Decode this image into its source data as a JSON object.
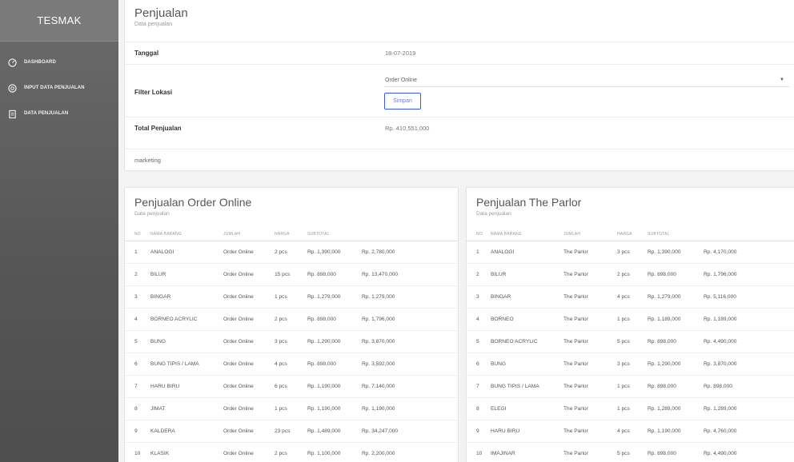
{
  "brand": "TESMAK",
  "nav": [
    {
      "label": "DASHBOARD",
      "icon": "dashboard-gauge-icon"
    },
    {
      "label": "INPUT DATA PENJUALAN",
      "icon": "input-circle-icon"
    },
    {
      "label": "DATA PENJUALAN",
      "icon": "clipboard-icon"
    }
  ],
  "header": {
    "title": "Penjualan",
    "subtitle": "Data penjualan"
  },
  "form": {
    "tanggal_label": "Tanggal",
    "tanggal_value": "18-07-2019",
    "filter_label": "Filter Lokasi",
    "filter_value": "Order Online",
    "simpan_label": "Simpan",
    "total_label": "Total Penjualan",
    "total_value": "Rp. 410,551,000",
    "note": "marketing"
  },
  "tables": [
    {
      "title": "Penjualan Order Online",
      "subtitle": "Data penjualan",
      "headers": [
        "NO",
        "NAMA BARANG",
        "JUMLAH",
        "HARGA",
        "SUBTOTAL",
        ""
      ],
      "rows": [
        [
          "1",
          "ANALOGI",
          "Order Online",
          "2 pcs",
          "Rp. 1,390,000",
          "Rp. 2,780,000"
        ],
        [
          "2",
          "BILUR",
          "Order Online",
          "15 pcs",
          "Rp. 898,000",
          "Rp. 13,470,000"
        ],
        [
          "3",
          "BINGAR",
          "Order Online",
          "1 pcs",
          "Rp. 1,279,000",
          "Rp. 1,279,000"
        ],
        [
          "4",
          "BORNEO ACRYLIC",
          "Order Online",
          "2 pcs",
          "Rp. 898,000",
          "Rp. 1,796,000"
        ],
        [
          "5",
          "BUNG",
          "Order Online",
          "3 pcs",
          "Rp. 1,290,000",
          "Rp. 3,870,000"
        ],
        [
          "6",
          "BUNG TIPIS / LAMA",
          "Order Online",
          "4 pcs",
          "Rp. 898,000",
          "Rp. 3,592,000"
        ],
        [
          "7",
          "HARU BIRU",
          "Order Online",
          "6 pcs",
          "Rp. 1,190,000",
          "Rp. 7,140,000"
        ],
        [
          "8",
          "JIMAT",
          "Order Online",
          "1 pcs",
          "Rp. 1,190,000",
          "Rp. 1,190,000"
        ],
        [
          "9",
          "KALDERA",
          "Order Online",
          "23 pcs",
          "Rp. 1,489,000",
          "Rp. 34,247,000"
        ],
        [
          "10",
          "KLASIK",
          "Order Online",
          "2 pcs",
          "Rp. 1,100,000",
          "Rp. 2,200,000"
        ]
      ]
    },
    {
      "title": "Penjualan The Parlor",
      "subtitle": "Data penjualan",
      "headers": [
        "NO",
        "NAMA BARANG",
        "JUMLAH",
        "HARGA",
        "SUBTOTAL",
        ""
      ],
      "rows": [
        [
          "1",
          "ANALOGI",
          "The Parlor",
          "3 pcs",
          "Rp. 1,390,000",
          "Rp. 4,170,000"
        ],
        [
          "2",
          "BILUR",
          "The Parlor",
          "2 pcs",
          "Rp. 898,000",
          "Rp. 1,796,000"
        ],
        [
          "3",
          "BINGAR",
          "The Parlor",
          "4 pcs",
          "Rp. 1,279,000",
          "Rp. 5,116,000"
        ],
        [
          "4",
          "BORNEO",
          "The Parlor",
          "1 pcs",
          "Rp. 1,189,000",
          "Rp. 1,189,000"
        ],
        [
          "5",
          "BORNEO ACRYLIC",
          "The Parlor",
          "5 pcs",
          "Rp. 898,000",
          "Rp. 4,490,000"
        ],
        [
          "6",
          "BUNG",
          "The Parlor",
          "3 pcs",
          "Rp. 1,290,000",
          "Rp. 3,870,000"
        ],
        [
          "7",
          "BUNG TIPIS / LAMA",
          "The Parlor",
          "1 pcs",
          "Rp. 898,000",
          "Rp. 898,000"
        ],
        [
          "8",
          "ELEGI",
          "The Parlor",
          "1 pcs",
          "Rp. 1,289,000",
          "Rp. 1,289,000"
        ],
        [
          "9",
          "HARU BIRU",
          "The Parlor",
          "4 pcs",
          "Rp. 1,190,000",
          "Rp. 4,760,000"
        ],
        [
          "10",
          "IMAJINAR",
          "The Parlor",
          "5 pcs",
          "Rp. 898,000",
          "Rp. 4,490,000"
        ]
      ]
    }
  ]
}
